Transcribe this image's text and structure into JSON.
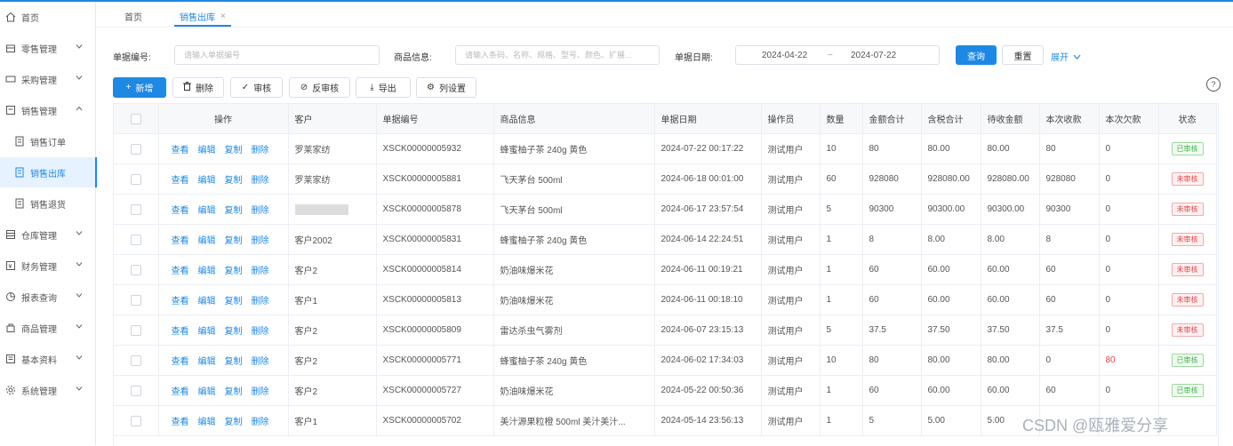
{
  "sidebar": {
    "items": [
      {
        "label": "首页",
        "icon": "home-icon",
        "chevron": false
      },
      {
        "label": "零售管理",
        "icon": "store-icon",
        "chevron": true
      },
      {
        "label": "采购管理",
        "icon": "cart-icon",
        "chevron": true
      },
      {
        "label": "销售管理",
        "icon": "sales-icon",
        "chevron": true,
        "expanded": true
      },
      {
        "label": "销售订单",
        "icon": "doc-icon",
        "sub": true
      },
      {
        "label": "销售出库",
        "icon": "doc-icon",
        "sub": true,
        "active": true
      },
      {
        "label": "销售退货",
        "icon": "doc-icon",
        "sub": true
      },
      {
        "label": "仓库管理",
        "icon": "warehouse-icon",
        "chevron": true
      },
      {
        "label": "财务管理",
        "icon": "finance-icon",
        "chevron": true
      },
      {
        "label": "报表查询",
        "icon": "report-icon",
        "chevron": true
      },
      {
        "label": "商品管理",
        "icon": "goods-icon",
        "chevron": true
      },
      {
        "label": "基本资料",
        "icon": "data-icon",
        "chevron": true
      },
      {
        "label": "系统管理",
        "icon": "gear-icon",
        "chevron": true
      }
    ]
  },
  "tabs": [
    {
      "label": "首页"
    },
    {
      "label": "销售出库",
      "closable": "×"
    }
  ],
  "filters": {
    "bill_no_label": "单据编号:",
    "bill_no_placeholder": "请输入单据编号",
    "goods_label": "商品信息:",
    "goods_placeholder": "请输入条码、名称、规格、型号、颜色、扩展...",
    "date_label": "单据日期:",
    "date_start": "2024-04-22",
    "date_sep": "~",
    "date_end": "2024-07-22",
    "search": "查询",
    "reset": "重置",
    "expand": "展开"
  },
  "toolbar": {
    "add": "新增",
    "delete": "删除",
    "approve": "审核",
    "unapprove": "反审核",
    "export": "导出",
    "columns": "列设置",
    "help": "?"
  },
  "table": {
    "headers": [
      "操作",
      "客户",
      "单据编号",
      "商品信息",
      "单据日期",
      "操作员",
      "数量",
      "金额合计",
      "含税合计",
      "待收金额",
      "本次收款",
      "本次欠款",
      "状态"
    ],
    "actions": [
      "查看",
      "编辑",
      "复制",
      "删除"
    ],
    "rows": [
      {
        "customer": "罗莱家纺",
        "no": "XSCK00000005932",
        "goods": "蜂蜜柚子茶 240g 黄色",
        "date": "2024-07-22 00:17:22",
        "op": "测试用户",
        "qty": "10",
        "amount": "80",
        "tax": "80.00",
        "due": "80.00",
        "recv": "80",
        "debt": "0",
        "status": "已审核",
        "status_ok": true
      },
      {
        "customer": "罗莱家纺",
        "no": "XSCK00000005881",
        "goods": "飞天茅台 500ml",
        "date": "2024-06-18 00:01:00",
        "op": "测试用户",
        "qty": "60",
        "amount": "928080",
        "tax": "928080.00",
        "due": "928080.00",
        "recv": "928080",
        "debt": "0",
        "status": "未审核",
        "status_ok": false
      },
      {
        "customer": "",
        "blurred": true,
        "no": "XSCK00000005878",
        "goods": "飞天茅台 500ml",
        "date": "2024-06-17 23:57:54",
        "op": "测试用户",
        "qty": "5",
        "amount": "90300",
        "tax": "90300.00",
        "due": "90300.00",
        "recv": "90300",
        "debt": "0",
        "status": "未审核",
        "status_ok": false
      },
      {
        "customer": "客户2002",
        "no": "XSCK00000005831",
        "goods": "蜂蜜柚子茶 240g 黄色",
        "date": "2024-06-14 22:24:51",
        "op": "测试用户",
        "qty": "1",
        "amount": "8",
        "tax": "8.00",
        "due": "8.00",
        "recv": "8",
        "debt": "0",
        "status": "未审核",
        "status_ok": false
      },
      {
        "customer": "客户2",
        "no": "XSCK00000005814",
        "goods": "奶油味爆米花",
        "date": "2024-06-11 00:19:21",
        "op": "测试用户",
        "qty": "1",
        "amount": "60",
        "tax": "60.00",
        "due": "60.00",
        "recv": "60",
        "debt": "0",
        "status": "未审核",
        "status_ok": false
      },
      {
        "customer": "客户1",
        "no": "XSCK00000005813",
        "goods": "奶油味爆米花",
        "date": "2024-06-11 00:18:10",
        "op": "测试用户",
        "qty": "1",
        "amount": "60",
        "tax": "60.00",
        "due": "60.00",
        "recv": "60",
        "debt": "0",
        "status": "未审核",
        "status_ok": false
      },
      {
        "customer": "客户2",
        "no": "XSCK00000005809",
        "goods": "雷达杀虫气雾剂",
        "date": "2024-06-07 23:15:13",
        "op": "测试用户",
        "qty": "5",
        "amount": "37.5",
        "tax": "37.50",
        "due": "37.50",
        "recv": "37.5",
        "debt": "0",
        "status": "未审核",
        "status_ok": false
      },
      {
        "customer": "客户2",
        "no": "XSCK00000005771",
        "goods": "蜂蜜柚子茶 240g 黄色",
        "date": "2024-06-02 17:34:03",
        "op": "测试用户",
        "qty": "10",
        "amount": "80",
        "tax": "80.00",
        "due": "80.00",
        "recv": "0",
        "debt": "80",
        "debt_red": true,
        "status": "已审核",
        "status_ok": true
      },
      {
        "customer": "客户2",
        "no": "XSCK00000005727",
        "goods": "奶油味爆米花",
        "date": "2024-05-22 00:50:36",
        "op": "测试用户",
        "qty": "1",
        "amount": "60",
        "tax": "60.00",
        "due": "60.00",
        "recv": "60",
        "debt": "0",
        "status": "已审核",
        "status_ok": true
      },
      {
        "customer": "客户1",
        "no": "XSCK00000005702",
        "goods": "美汁源果粒橙 500ml 美汁美汁...",
        "date": "2024-05-14 23:56:13",
        "op": "测试用户",
        "qty": "1",
        "amount": "5",
        "tax": "5.00",
        "due": "5.00",
        "recv": "",
        "debt": "",
        "status": "",
        "status_ok": true
      }
    ]
  },
  "watermark": "CSDN @瓯雅爱分享"
}
